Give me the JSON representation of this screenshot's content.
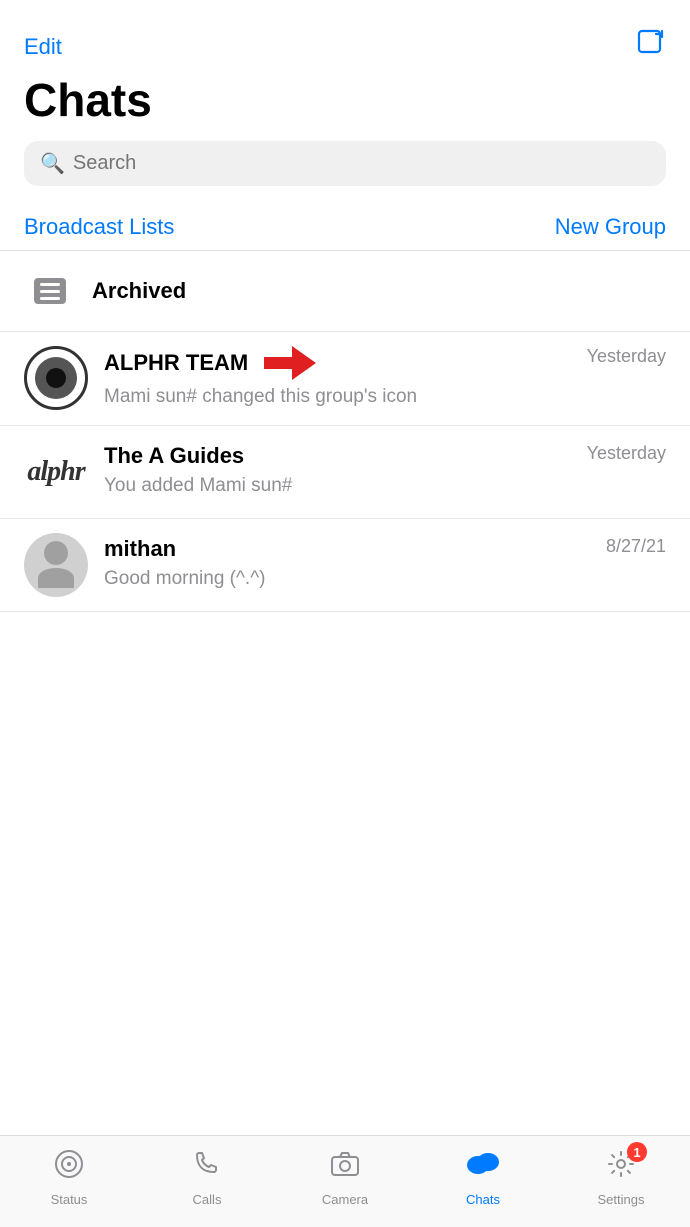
{
  "header": {
    "edit_label": "Edit",
    "title": "Chats",
    "search_placeholder": "Search"
  },
  "actions": {
    "broadcast_label": "Broadcast Lists",
    "new_group_label": "New Group"
  },
  "archived": {
    "label": "Archived"
  },
  "chats": [
    {
      "id": "alphr-team",
      "name": "ALPHR TEAM",
      "preview": "Mami sun# changed this group's icon",
      "time": "Yesterday",
      "has_arrow": true,
      "avatar_type": "target"
    },
    {
      "id": "a-guides",
      "name": "The A Guides",
      "preview": "You added Mami sun#",
      "time": "Yesterday",
      "has_arrow": false,
      "avatar_type": "text",
      "avatar_text": "alphr"
    },
    {
      "id": "mithan",
      "name": "mithan",
      "preview": "Good morning (^.^)",
      "time": "8/27/21",
      "has_arrow": false,
      "avatar_type": "person"
    }
  ],
  "bottom_nav": {
    "items": [
      {
        "id": "status",
        "label": "Status",
        "active": false,
        "badge": 0
      },
      {
        "id": "calls",
        "label": "Calls",
        "active": false,
        "badge": 0
      },
      {
        "id": "camera",
        "label": "Camera",
        "active": false,
        "badge": 0
      },
      {
        "id": "chats",
        "label": "Chats",
        "active": true,
        "badge": 0
      },
      {
        "id": "settings",
        "label": "Settings",
        "active": false,
        "badge": 1
      }
    ]
  }
}
